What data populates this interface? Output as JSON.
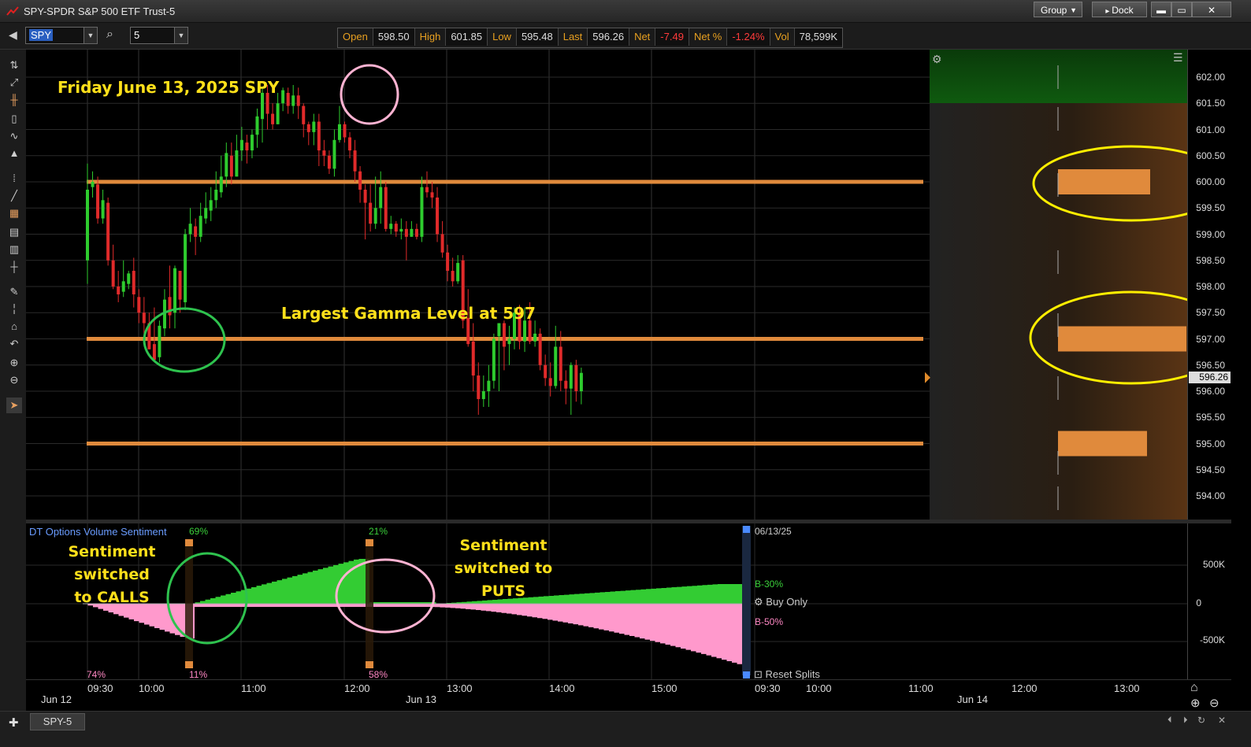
{
  "window": {
    "title": "SPY-SPDR S&P 500 ETF Trust-5",
    "group_label": "Group",
    "dock_label": "Dock"
  },
  "toolbar": {
    "symbol": "SPY",
    "interval": "5"
  },
  "quote": {
    "open_label": "Open",
    "open": "598.50",
    "high_label": "High",
    "high": "601.85",
    "low_label": "Low",
    "low": "595.48",
    "last_label": "Last",
    "last": "596.26",
    "net_label": "Net",
    "net": "-7.49",
    "netpct_label": "Net %",
    "netpct": "-1.24%",
    "vol_label": "Vol",
    "vol": "78,599K"
  },
  "annotations": {
    "title": "Friday June 13, 2025 SPY",
    "gamma": "Largest Gamma Level at 597",
    "calls_line1": "Sentiment switched",
    "calls_line2": "to CALLS",
    "puts_line1": "Sentiment",
    "puts_line2": "switched to PUTS"
  },
  "price_scale": [
    "602.00",
    "601.50",
    "601.00",
    "600.50",
    "600.00",
    "599.50",
    "599.00",
    "598.50",
    "598.00",
    "597.50",
    "597.00",
    "596.50",
    "596.00",
    "595.50",
    "595.00",
    "594.50",
    "594.00"
  ],
  "last_price_marker": "596.26",
  "gamma_levels": [
    600,
    597,
    595
  ],
  "sentiment": {
    "title": "DT Options Volume Sentiment",
    "pct_calls_top": "69%",
    "pct_calls_bottom": "11%",
    "pct_puts_top": "21%",
    "pct_puts_bottom": "58%",
    "pct_left_bottom": "74%",
    "date": "06/13/25",
    "bull_label": "B-30%",
    "bear_label": "B-50%",
    "buy_only": "Buy Only",
    "reset_splits": "Reset Splits",
    "scale": [
      "500K",
      "0",
      "-500K"
    ]
  },
  "time_axis": {
    "times": [
      "09:30",
      "10:00",
      "11:00",
      "12:00",
      "13:00",
      "14:00",
      "15:00",
      "09:30",
      "10:00",
      "11:00",
      "12:00",
      "13:00"
    ],
    "dates": [
      "Jun 12",
      "Jun 13",
      "Jun 14"
    ]
  },
  "tabs": {
    "active": "SPY-5"
  },
  "colors": {
    "up": "#2ecc2e",
    "down": "#e02a2a",
    "gamma": "#e08a3c",
    "annotation": "#ffe01a",
    "calls_area": "#33cc33",
    "puts_area": "#ff99cc"
  }
}
